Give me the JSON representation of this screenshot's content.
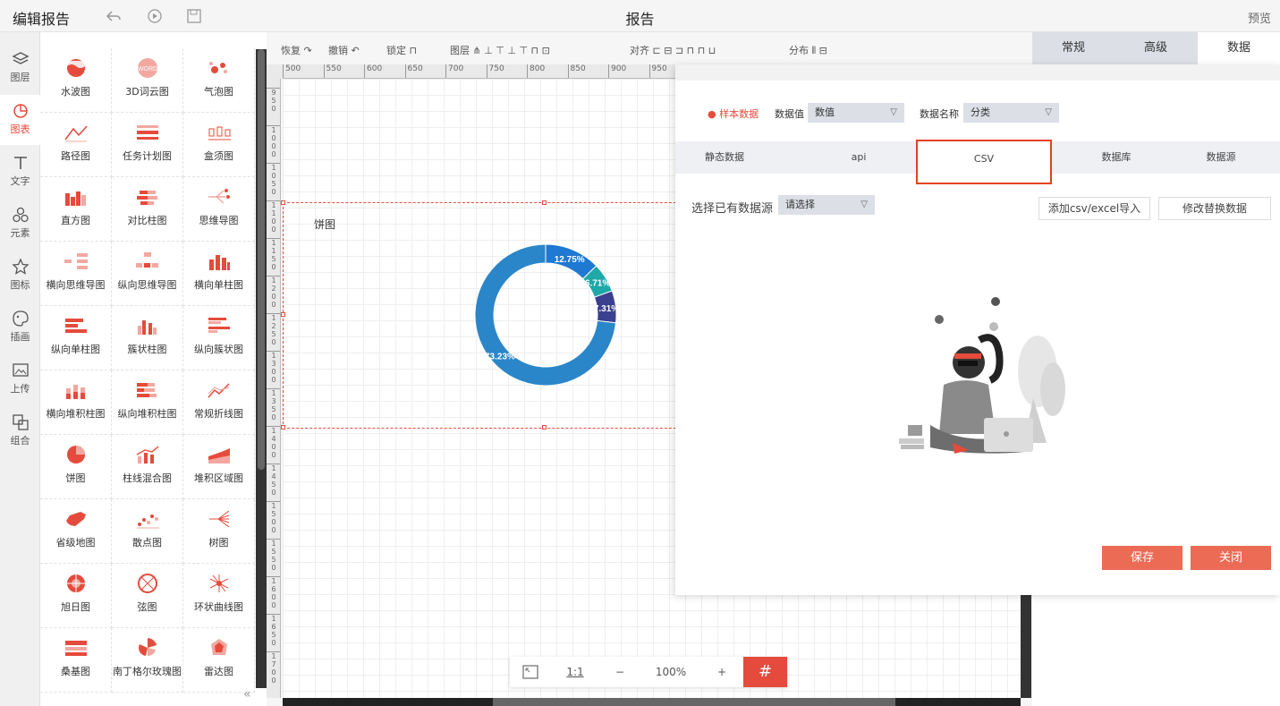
{
  "topbar": {
    "title": "编辑报告",
    "center_title": "报告",
    "preview": "预览"
  },
  "leftnav": [
    {
      "label": "图层",
      "icon": "layers-icon"
    },
    {
      "label": "图表",
      "icon": "chart-icon",
      "active": true
    },
    {
      "label": "文字",
      "icon": "text-icon"
    },
    {
      "label": "元素",
      "icon": "shapes-icon"
    },
    {
      "label": "图标",
      "icon": "star-icon"
    },
    {
      "label": "插画",
      "icon": "palette-icon"
    },
    {
      "label": "上传",
      "icon": "upload-image-icon"
    },
    {
      "label": "组合",
      "icon": "group-icon"
    }
  ],
  "palette": [
    {
      "label": "水波图",
      "icon": "water-ball-icon"
    },
    {
      "label": "3D词云图",
      "icon": "word-cloud-icon"
    },
    {
      "label": "气泡图",
      "icon": "bubble-icon"
    },
    {
      "label": "路径图",
      "icon": "path-icon"
    },
    {
      "label": "任务计划图",
      "icon": "gantt-icon"
    },
    {
      "label": "盒须图",
      "icon": "boxplot-icon"
    },
    {
      "label": "直方图",
      "icon": "histogram-icon"
    },
    {
      "label": "对比柱图",
      "icon": "compare-bar-icon"
    },
    {
      "label": "思维导图",
      "icon": "mindmap-icon"
    },
    {
      "label": "横向思维导图",
      "icon": "h-mindmap-icon"
    },
    {
      "label": "纵向思维导图",
      "icon": "v-mindmap-icon"
    },
    {
      "label": "横向单柱图",
      "icon": "h-bar-icon"
    },
    {
      "label": "纵向单柱图",
      "icon": "v-bar-icon"
    },
    {
      "label": "簇状柱图",
      "icon": "cluster-bar-icon"
    },
    {
      "label": "纵向簇状图",
      "icon": "v-cluster-icon"
    },
    {
      "label": "横向堆积柱图",
      "icon": "h-stack-icon"
    },
    {
      "label": "纵向堆积柱图",
      "icon": "v-stack-icon"
    },
    {
      "label": "常规折线图",
      "icon": "line-icon"
    },
    {
      "label": "饼图",
      "icon": "pie-icon"
    },
    {
      "label": "柱线混合图",
      "icon": "bar-line-icon"
    },
    {
      "label": "堆积区域图",
      "icon": "area-icon"
    },
    {
      "label": "省级地图",
      "icon": "map-icon"
    },
    {
      "label": "散点图",
      "icon": "scatter-icon"
    },
    {
      "label": "树图",
      "icon": "tree-icon"
    },
    {
      "label": "旭日图",
      "icon": "sunburst-icon"
    },
    {
      "label": "弦图",
      "icon": "chord-icon"
    },
    {
      "label": "环状曲线图",
      "icon": "ring-curve-icon"
    },
    {
      "label": "桑基图",
      "icon": "sankey-icon"
    },
    {
      "label": "南丁格尔玫瑰图",
      "icon": "rose-icon"
    },
    {
      "label": "雷达图",
      "icon": "radar-icon"
    }
  ],
  "toolbar": {
    "redo": "恢复",
    "undo": "撤销",
    "lock": "锁定",
    "layer": "图层",
    "align": "对齐",
    "distribute": "分布"
  },
  "ruler": {
    "h": [
      "500",
      "550",
      "600",
      "650",
      "700",
      "750",
      "800",
      "850",
      "900",
      "950"
    ],
    "v": [
      "950",
      "1000",
      "1050",
      "1100",
      "1150",
      "1200",
      "1250",
      "1300",
      "1350",
      "1400",
      "1450",
      "1500",
      "1550",
      "1600",
      "1650",
      "1700"
    ]
  },
  "chart_title": "饼图",
  "chart_data": {
    "type": "pie",
    "style": "donut",
    "slices": [
      {
        "label": "12.75%",
        "value": 12.75,
        "color": "#1f78d1"
      },
      {
        "label": "6.71%",
        "value": 6.71,
        "color": "#1fa8a8"
      },
      {
        "label": "7.31%",
        "value": 7.31,
        "color": "#3b3f8f"
      },
      {
        "label": "73.23%",
        "value": 73.23,
        "color": "#2a86c8"
      }
    ]
  },
  "zoombar": {
    "fit_icon": "fit-screen-icon",
    "ratio": "1:1",
    "minus": "−",
    "zoom": "100%",
    "plus": "+",
    "grid": "#"
  },
  "right_tabs": [
    {
      "label": "常规"
    },
    {
      "label": "高级"
    },
    {
      "label": "数据",
      "active": true
    }
  ],
  "data_panel": {
    "sample": "● 样本数据",
    "value_label": "数据值",
    "value_select": "数值",
    "name_label": "数据名称",
    "name_select": "分类",
    "source_tabs": [
      {
        "label": "静态数据"
      },
      {
        "label": "api"
      },
      {
        "label": "CSV",
        "active": true
      },
      {
        "label": "数据库"
      },
      {
        "label": "数据源"
      }
    ],
    "existing_label": "选择已有数据源",
    "existing_select": "请选择",
    "import_btn": "添加csv/excel导入",
    "replace_btn": "修改替换数据",
    "save_btn": "保存",
    "close_btn": "关闭"
  },
  "colors": {
    "accent": "#e54b3c",
    "button": "#ec6b55",
    "highlight_border": "#e5411f"
  }
}
